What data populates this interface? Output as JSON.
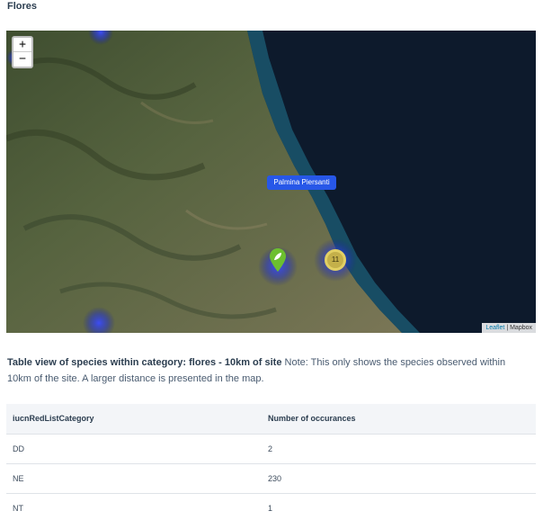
{
  "section": {
    "title": "Flores"
  },
  "map": {
    "zoom_in": "+",
    "zoom_out": "−",
    "tooltip": "Palmina Piersanti",
    "cluster_count": "11",
    "attribution_leaflet": "Leaflet",
    "attribution_sep": " | ",
    "attribution_mapbox": "Mapbox"
  },
  "note": {
    "title": "Table view of species within category: flores - 10km of site",
    "text": " Note: This only shows the species observed within 10km of the site. A larger distance is presented in the map."
  },
  "table": {
    "headers": [
      "iucnRedListCategory",
      "Number of occurances"
    ],
    "rows": [
      {
        "category": "DD",
        "count": "2"
      },
      {
        "category": "NE",
        "count": "230"
      },
      {
        "category": "NT",
        "count": "1"
      }
    ]
  }
}
